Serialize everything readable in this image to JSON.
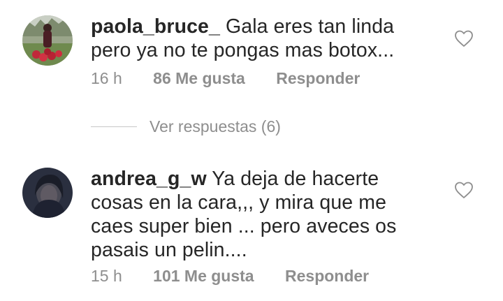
{
  "comments": [
    {
      "username": "paola_bruce_",
      "text": "Gala eres tan linda pero ya no te pongas mas botox...",
      "time": "16 h",
      "likes": "86 Me gusta",
      "reply": "Responder",
      "avatar_icon": "user-photo-avatar",
      "like_icon": "heart-outline-icon"
    },
    {
      "username": "andrea_g_w",
      "text": "Ya deja de hacerte cosas en la cara,,, y mira que me caes super bien ... pero aveces os pasais un pelin....",
      "time": "15 h",
      "likes": "101 Me gusta",
      "reply": "Responder",
      "avatar_icon": "user-photo-avatar",
      "like_icon": "heart-outline-icon"
    }
  ],
  "view_replies": {
    "label": "Ver respuestas (6)"
  },
  "colors": {
    "text": "#262626",
    "secondary": "#8e8e8e",
    "divider": "#c7c7c7"
  }
}
